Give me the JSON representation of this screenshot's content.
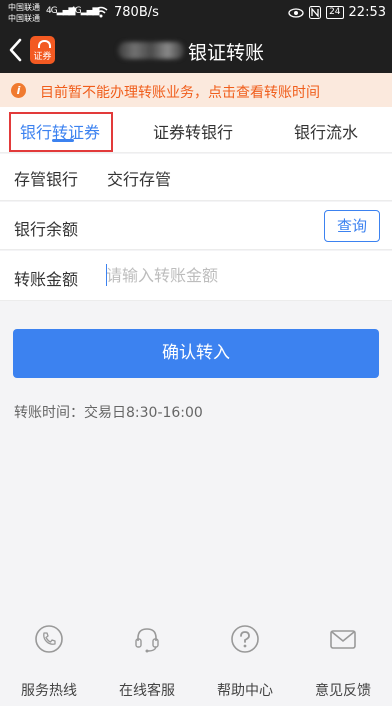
{
  "status_bar": {
    "carrier1": "中国联通",
    "carrier2": "中国联通",
    "sig1": "4G",
    "sig2": "4G",
    "speed": "780B/s",
    "battery": "24",
    "time": "22:53"
  },
  "nav": {
    "logo_text": "证券",
    "title": "银证转账"
  },
  "notice": {
    "icon": "i",
    "text": "目前暂不能办理转账业务，点击查看转账时间"
  },
  "tabs": [
    {
      "label": "银行转证券"
    },
    {
      "label": "证券转银行"
    },
    {
      "label": "银行流水"
    }
  ],
  "form": {
    "depository_label": "存管银行",
    "depository_value": "交行存管",
    "balance_label": "银行余额",
    "query_label": "查询",
    "amount_label": "转账金额",
    "amount_placeholder": "请输入转账金额",
    "amount_value": ""
  },
  "confirm_label": "确认转入",
  "time_info": "转账时间：交易日8:30-16:00",
  "bottom_nav": [
    {
      "label": "服务热线",
      "icon": "phone-icon"
    },
    {
      "label": "在线客服",
      "icon": "headset-icon"
    },
    {
      "label": "帮助中心",
      "icon": "help-icon"
    },
    {
      "label": "意见反馈",
      "icon": "mail-icon"
    }
  ],
  "colors": {
    "accent": "#3c82f0",
    "notice_text": "#f05e1c",
    "notice_bg": "#fbe9dd",
    "highlight_box": "#e23a3a",
    "header_bg": "#1f1f1f"
  }
}
